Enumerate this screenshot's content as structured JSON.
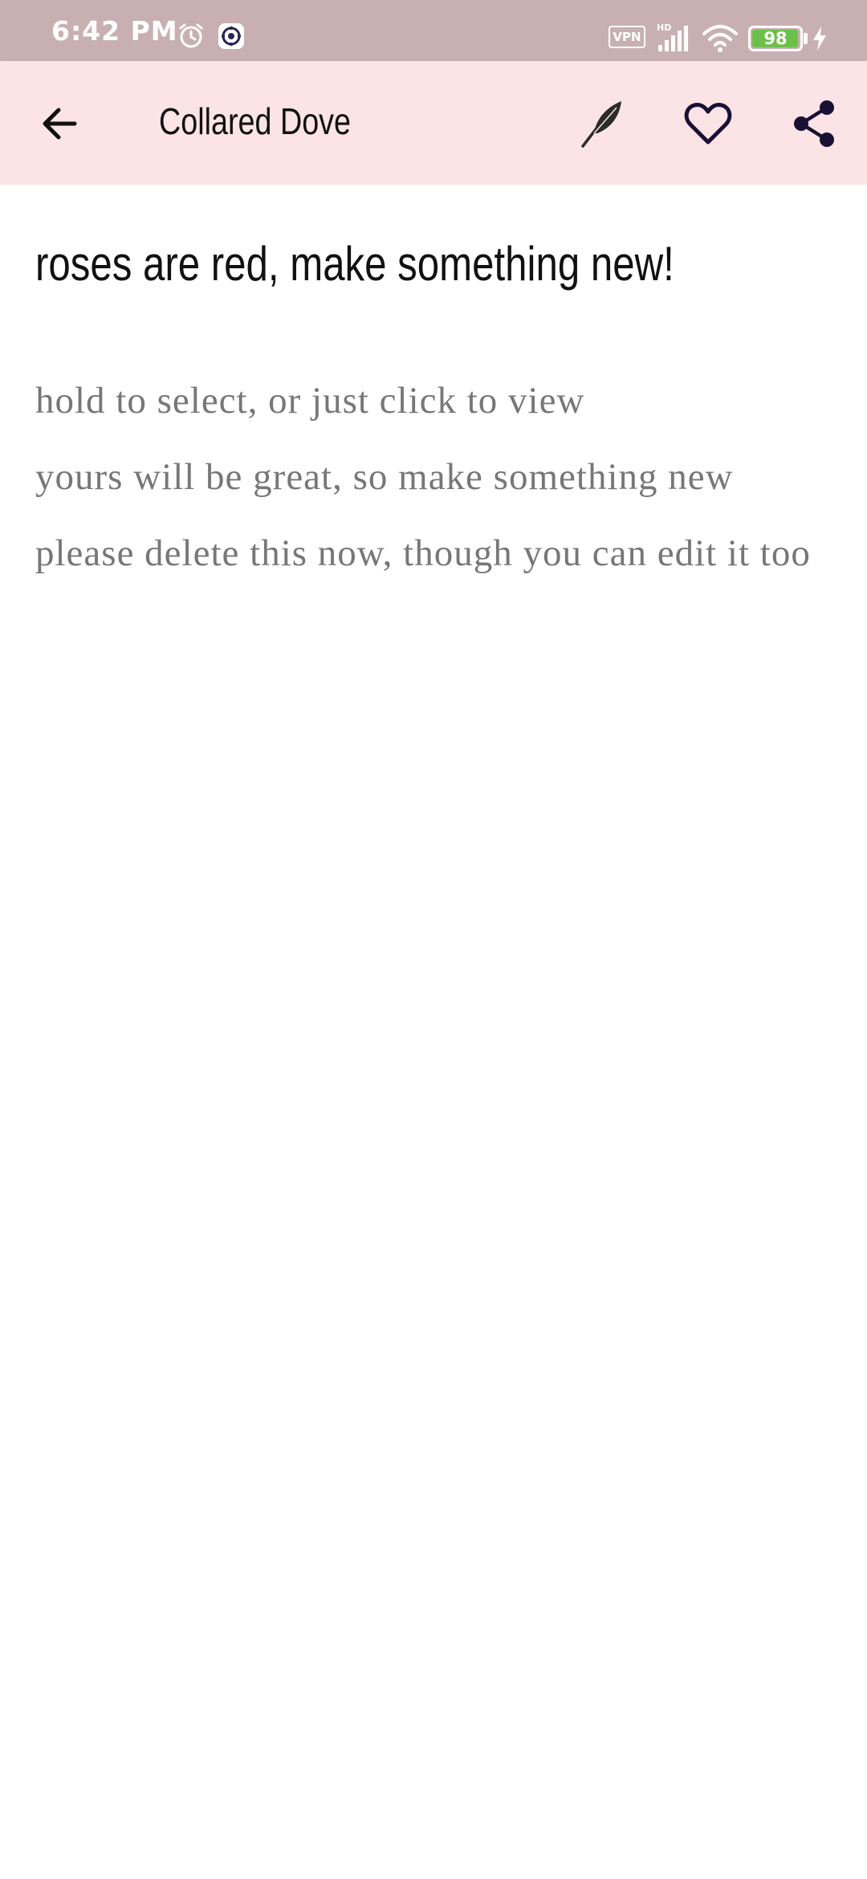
{
  "status_bar": {
    "time": "6:42 PM",
    "vpn_label": "VPN",
    "hd_label": "HD",
    "battery_level": 98,
    "battery_text": "98",
    "icons": [
      "alarm-icon",
      "app-notification-icon",
      "vpn-icon",
      "signal-icon",
      "wifi-icon",
      "battery-icon",
      "charging-icon"
    ]
  },
  "app_bar": {
    "title": "Collared Dove",
    "back_icon": "arrow-left-icon",
    "actions": [
      {
        "name": "edit",
        "icon": "feather-quill-icon"
      },
      {
        "name": "favorite",
        "icon": "heart-outline-icon"
      },
      {
        "name": "share",
        "icon": "share-icon"
      }
    ]
  },
  "poem": {
    "title": "roses are red, make something new!",
    "lines": [
      "hold to select, or just click to view",
      "yours will be great, so make something new",
      "please delete this now, though you can edit it too"
    ]
  },
  "colors": {
    "status_bar_bg": "#c8b0b2",
    "app_bar_bg": "#fce4e6",
    "icon_dark": "#1a1033",
    "body_text": "#777777",
    "title_text": "#111111",
    "battery_fill": "#6cc04a"
  }
}
